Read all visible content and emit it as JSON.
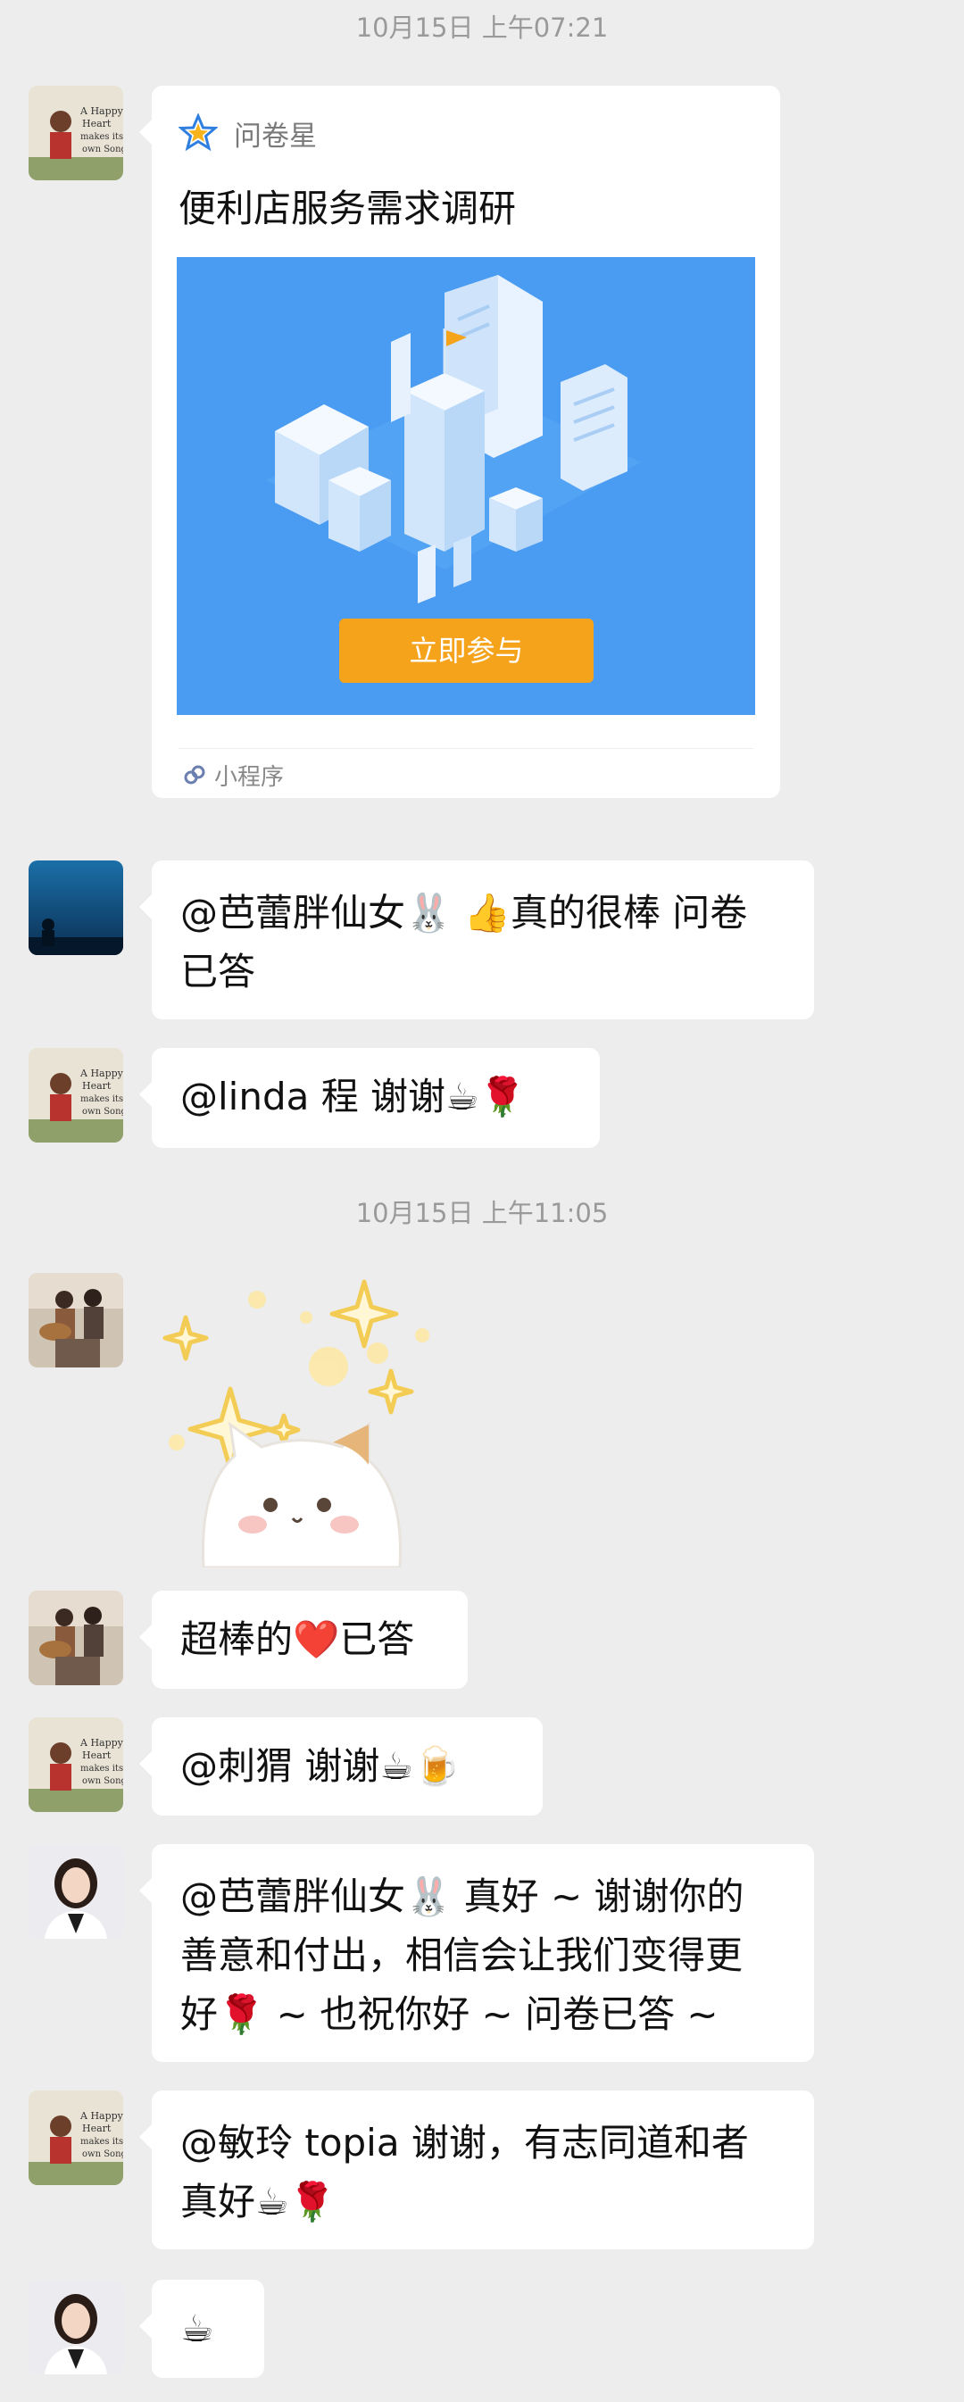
{
  "timestamps": [
    "10月15日 上午07:21",
    "10月15日 上午11:05"
  ],
  "card": {
    "source": "问卷星",
    "title": "便利店服务需求调研",
    "cta": "立即参与",
    "footer": "小程序"
  },
  "messages": [
    {
      "avatar": "avatar-happy-heart",
      "text": "@芭蕾胖仙女🐰 👍真的很棒 问卷",
      "text2": "已答"
    },
    {
      "avatar": "avatar-happy-heart",
      "text": "@linda 程  谢谢☕🌹"
    },
    {
      "avatar": "avatar-guitar-couple",
      "sticker": "sparkle-cat-sticker"
    },
    {
      "avatar": "avatar-guitar-couple",
      "text": "超棒的❤️已答"
    },
    {
      "avatar": "avatar-happy-heart",
      "text": "@刺猬  谢谢☕🍺"
    },
    {
      "avatar": "avatar-woman-portrait",
      "lines": [
        "@芭蕾胖仙女🐰 真好 ~ 谢谢你的",
        "善意和付出，相信会让我们变得更",
        "好🌹 ~ 也祝你好 ~ 问卷已答 ~"
      ]
    },
    {
      "avatar": "avatar-happy-heart",
      "lines": [
        "@敏玲 topia 谢谢，有志同道和者",
        "真好☕🌹"
      ]
    },
    {
      "avatar": "avatar-woman-portrait",
      "text": "☕"
    }
  ],
  "colors": {
    "background": "#ededed",
    "bubble": "#ffffff",
    "cta": "#f5a31a",
    "card_image": "#4a9cf2"
  }
}
